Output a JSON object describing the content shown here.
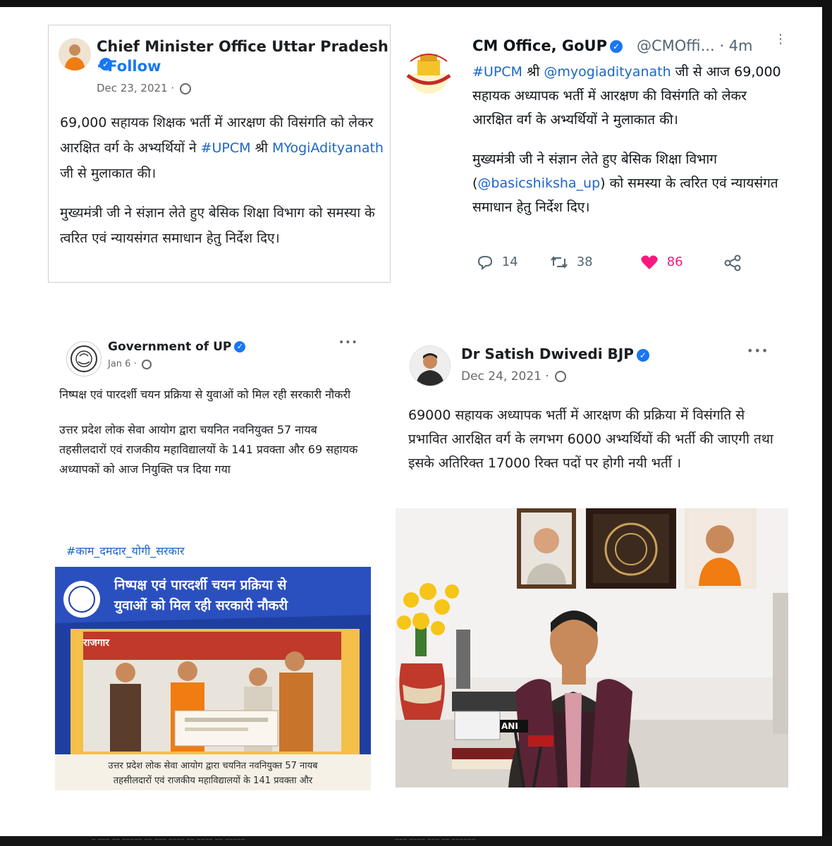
{
  "panels": {
    "fb_cmo": {
      "name": "Chief Minister Office Uttar Pradesh",
      "follow": "· Follow",
      "date": "Dec 23, 2021 ·",
      "para1_a": "69,000 सहायक शिक्षक भर्ती में आरक्षण की विसंगति को लेकर आरक्षित वर्ग के अभ्यर्थियों ने ",
      "para1_tag": "#UPCM",
      "para1_b": " श्री ",
      "para1_link": "MYogiAdityanath",
      "para1_c": " जी से मुलाकात की।",
      "para2": "मुख्यमंत्री जी ने संज्ञान लेते हुए बेसिक शिक्षा विभाग को समस्या के त्वरित एवं न्यायसंगत समाधान हेतु निर्देश दिए।"
    },
    "tw_cmo": {
      "name": "CM Office, GoUP",
      "handle": "@CMOffi... · 4m",
      "more": "⋮",
      "para1_tag": "#UPCM",
      "para1_a": " श्री ",
      "para1_link": "@myogiadityanath",
      "para1_b": " जी से आज 69,000 सहायक अध्यापक भर्ती में आरक्षण की विसंगति को लेकर आरक्षित वर्ग के अभ्यर्थियों ने मुलाकात की।",
      "para2_a": "मुख्यमंत्री जी ने संज्ञान लेते हुए बेसिक शिक्षा विभाग (",
      "para2_link": "@basicshiksha_up",
      "para2_b": ") को समस्या के त्वरित एवं न्यायसंगत समाधान हेतु निर्देश दिए।",
      "replies": "14",
      "retweets": "38",
      "likes": "86"
    },
    "fb_gov": {
      "name": "Government of UP",
      "date": "Jan 6 ·",
      "dots": "•••",
      "para1": "निष्पक्ष एवं पारदर्शी चयन प्रक्रिया से युवाओं को मिल रही सरकारी नौकरी",
      "para2": "उत्तर प्रदेश लोक सेवा आयोग द्वारा चयनित नवनियुक्त 57 नायब तहसीलदारों एवं राजकीय महाविद्यालयों के 141 प्रवक्ता और 69 सहायक अध्यापकों को आज नियुक्ति पत्र दिया गया",
      "hashtag": "#काम_दमदार_योगी_सरकार",
      "banner_title_1": "निष्पक्ष एवं पारदर्शी चयन प्रक्रिया से",
      "banner_title_2": "युवाओं को मिल रही सरकारी नौकरी",
      "banner_tag": "राजगार",
      "banner_caption_1": "उत्तर प्रदेश लोक सेवा आयोग द्वारा चयनित नवनियुक्त 57 नायब",
      "banner_caption_2": "तहसीलदारों एवं राजकीय महाविद्यालयों के 141 प्रवक्ता और"
    },
    "fb_satish": {
      "name": "Dr Satish Dwivedi BJP",
      "date": "Dec 24, 2021 ·",
      "dots": "•••",
      "body": "69000 सहायक अध्यापक भर्ती में आरक्षण की प्रक्रिया में विसंगति से प्रभावित आरक्षित वर्ग के लगभग 6000 अभ्यर्थियों की भर्ती की जाएगी तथा इसके अतिरिक्त 17000 रिक्त पदों पर होगी नयी भर्ती ।",
      "mic_label": "ANI"
    }
  },
  "colors": {
    "fb_blue": "#1877f2",
    "link_blue": "#1b66c9",
    "like_pink": "#f91880",
    "banner_blue": "#1f3fa0"
  },
  "icons": [
    "verified-badge-icon",
    "globe-icon",
    "reply-icon",
    "retweet-icon",
    "heart-icon",
    "share-icon",
    "more-icon"
  ]
}
